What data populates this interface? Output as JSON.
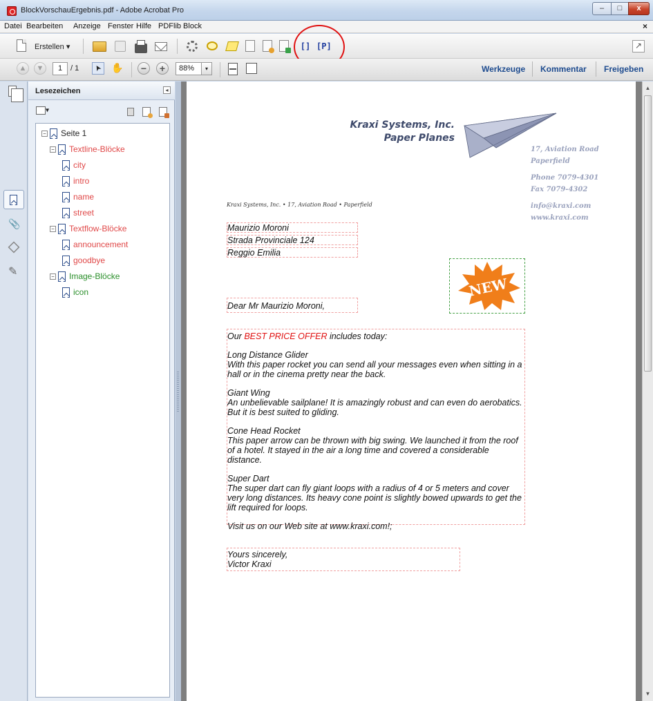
{
  "window": {
    "title": "BlockVorschauErgebnis.pdf - Adobe Acrobat Pro",
    "btn_min": "–",
    "btn_max": "□",
    "btn_close": "x"
  },
  "menu": {
    "items": [
      "Datei",
      "Bearbeiten",
      "Anzeige",
      "Fenster",
      "Hilfe",
      "PDFlib Block"
    ],
    "close": "×"
  },
  "toolbar": {
    "create_label": "Erstellen ▾",
    "block_btn_1": "[]",
    "block_btn_2": "[P]"
  },
  "nav": {
    "page_current": "1",
    "page_total": "/ 1",
    "zoom": "88%",
    "zoom_arrow": "▾",
    "tabs": [
      "Werkzeuge",
      "Kommentar",
      "Freigeben"
    ]
  },
  "bookmarks": {
    "title": "Lesezeichen",
    "collapse": "◂",
    "tree": [
      {
        "label": "Seite 1",
        "color": "#222222",
        "level": 0,
        "toggle": "⊟"
      },
      {
        "label": "Textline-Blöcke",
        "color": "#e04848",
        "level": 1,
        "toggle": "⊟"
      },
      {
        "label": "city",
        "color": "#e04848",
        "level": 2
      },
      {
        "label": "intro",
        "color": "#e04848",
        "level": 2
      },
      {
        "label": "name",
        "color": "#e04848",
        "level": 2
      },
      {
        "label": "street",
        "color": "#e04848",
        "level": 2
      },
      {
        "label": "Textflow-Blöcke",
        "color": "#e04848",
        "level": 1,
        "toggle": "⊟"
      },
      {
        "label": "announcement",
        "color": "#e04848",
        "level": 2
      },
      {
        "label": "goodbye",
        "color": "#e04848",
        "level": 2
      },
      {
        "label": "Image-Blöcke",
        "color": "#2b8f2b",
        "level": 1,
        "toggle": "⊟"
      },
      {
        "label": "icon",
        "color": "#2b8f2b",
        "level": 2
      }
    ]
  },
  "letter": {
    "company": "Kraxi Systems, Inc.",
    "tagline": "Paper Planes",
    "address": {
      "street": "17, Aviation Road",
      "city": "Paperfield",
      "phone": "Phone 7079-4301",
      "fax": "Fax 7079-4302",
      "email": "info@kraxi.com",
      "web": "www.kraxi.com"
    },
    "sender_line": "Kraxi Systems, Inc. • 17, Aviation Road • Paperfield",
    "recipient": {
      "name": "Maurizio Moroni",
      "street": "Strada Provinciale 124",
      "city": "Reggio Emilia"
    },
    "badge": "NEW",
    "salutation": "Dear Mr Maurizio Moroni,",
    "intro_pre": "Our ",
    "intro_offer": "BEST PRICE OFFER",
    "intro_post": " includes today:",
    "products": [
      {
        "name": "Long Distance Glider",
        "desc": "With this paper rocket you can send all your messages even when sitting in a hall or in the cinema pretty near the back."
      },
      {
        "name": "Giant Wing",
        "desc": "An unbelievable sailplane! It is amazingly robust and can even do aerobatics. But it is best suited to gliding."
      },
      {
        "name": "Cone Head Rocket",
        "desc": "This paper arrow can be thrown with big swing. We launched it from the roof of a hotel. It stayed in the air a long time and covered a considerable distance."
      },
      {
        "name": "Super Dart",
        "desc": "The super dart can fly giant loops with a radius of 4 or 5 meters and cover very long distances. Its heavy cone point is slightly bowed upwards to get the lift required for loops."
      }
    ],
    "visit": "Visit us on our Web site at www.kraxi.com!;",
    "closing": "Yours sincerely,",
    "signature": "Victor Kraxi"
  },
  "colors": {
    "block_outline": "#f0a0a0",
    "image_outline": "#44a044",
    "annotation": "#e01010",
    "badge": "#f07e1a"
  }
}
